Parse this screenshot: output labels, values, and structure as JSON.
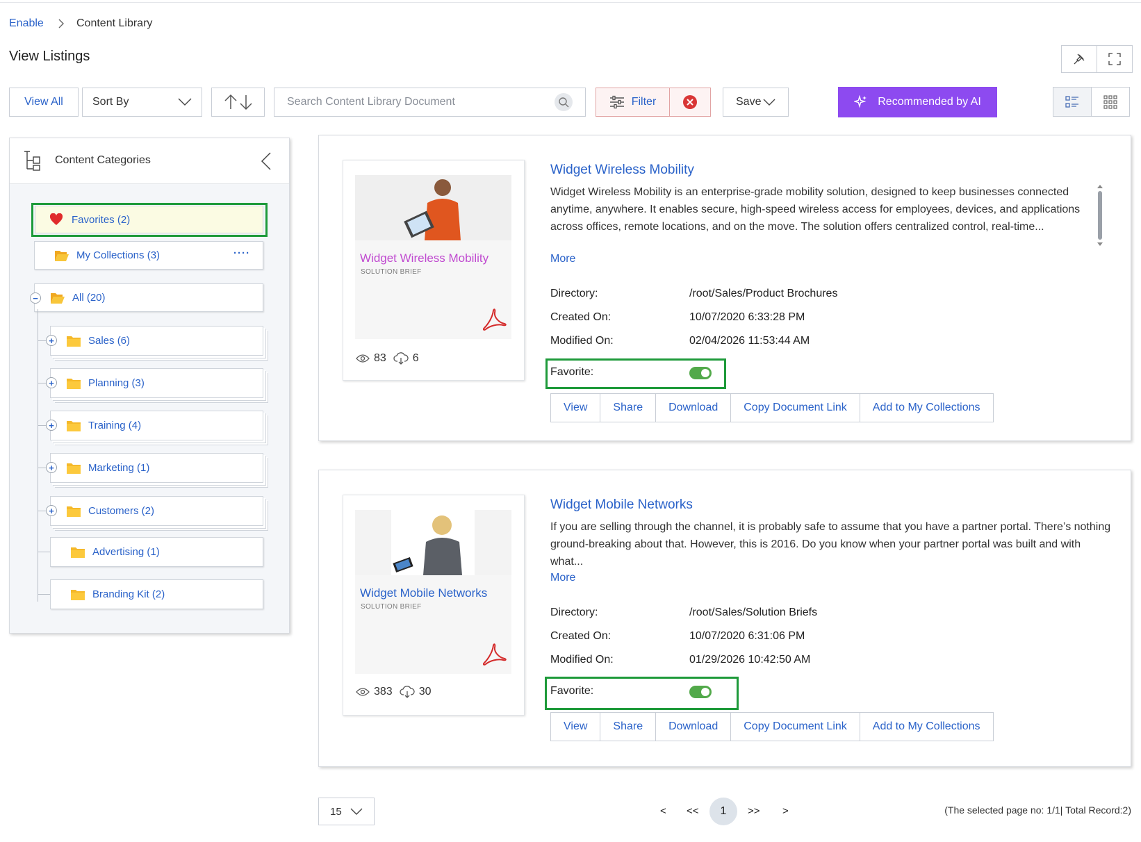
{
  "breadcrumb": {
    "root": "Enable",
    "current": "Content Library"
  },
  "page_title": "View Listings",
  "toolbar": {
    "view_all": "View All",
    "sort_by": "Sort By",
    "search_placeholder": "Search Content Library Document",
    "filter": "Filter",
    "save": "Save",
    "recommended": "Recommended by AI"
  },
  "sidebar": {
    "title": "Content Categories",
    "favorites": "Favorites (2)",
    "my_collections": "My Collections (3)",
    "all": "All (20)",
    "folders": [
      {
        "label": "Sales (6)",
        "expandable": true
      },
      {
        "label": "Planning (3)",
        "expandable": true
      },
      {
        "label": "Training (4)",
        "expandable": true
      },
      {
        "label": "Marketing (1)",
        "expandable": true
      },
      {
        "label": "Customers (2)",
        "expandable": true
      },
      {
        "label": "Advertising (1)",
        "expandable": false
      },
      {
        "label": "Branding Kit (2)",
        "expandable": false
      }
    ]
  },
  "labels": {
    "more": "More",
    "directory": "Directory:",
    "created_on": "Created On:",
    "modified_on": "Modified On:",
    "favorite": "Favorite:",
    "actions": [
      "View",
      "Share",
      "Download",
      "Copy Document Link",
      "Add to My Collections"
    ]
  },
  "documents": [
    {
      "title": "Widget Wireless Mobility",
      "thumb_title": "Widget Wireless Mobility",
      "thumb_subtitle": "SOLUTION BRIEF",
      "thumb_title_color": "#c04ad0",
      "views": "83",
      "downloads": "6",
      "description": "Widget Wireless Mobility is an enterprise-grade mobility solution, designed to keep businesses connected anytime, anywhere. It enables secure, high-speed wireless access for employees, devices, and applications across offices, remote locations, and on the move. The solution offers centralized control, real-time...",
      "directory": "/root/Sales/Product Brochures",
      "created_on": "10/07/2020 6:33:28 PM",
      "modified_on": "02/04/2026 11:53:44 AM",
      "favorite": true
    },
    {
      "title": "Widget Mobile Networks",
      "thumb_title": "Widget Mobile Networks",
      "thumb_subtitle": "SOLUTION BRIEF",
      "thumb_title_color": "#2a62c9",
      "views": "383",
      "downloads": "30",
      "description": "If you are selling through the channel, it is probably safe to assume that you have a partner portal. There’s nothing ground-breaking about that. However, this is 2016. Do you know when your partner portal was built and with what...",
      "directory": "/root/Sales/Solution Briefs",
      "created_on": "10/07/2020 6:31:06 PM",
      "modified_on": "01/29/2026 10:42:50 AM",
      "favorite": true
    }
  ],
  "pagination": {
    "page_size": "15",
    "prev": "<",
    "first": "<<",
    "current": "1",
    "last": ">>",
    "next": ">",
    "info": "(The selected page no: 1/1| Total Record:2)"
  },
  "colors": {
    "accent": "#2a62c9",
    "ai_button": "#8d4af0",
    "highlight_border": "#1e9a3a",
    "toggle_on": "#52a94a",
    "pdf_icon": "#d42b2b",
    "folder": "#f5b92a"
  }
}
